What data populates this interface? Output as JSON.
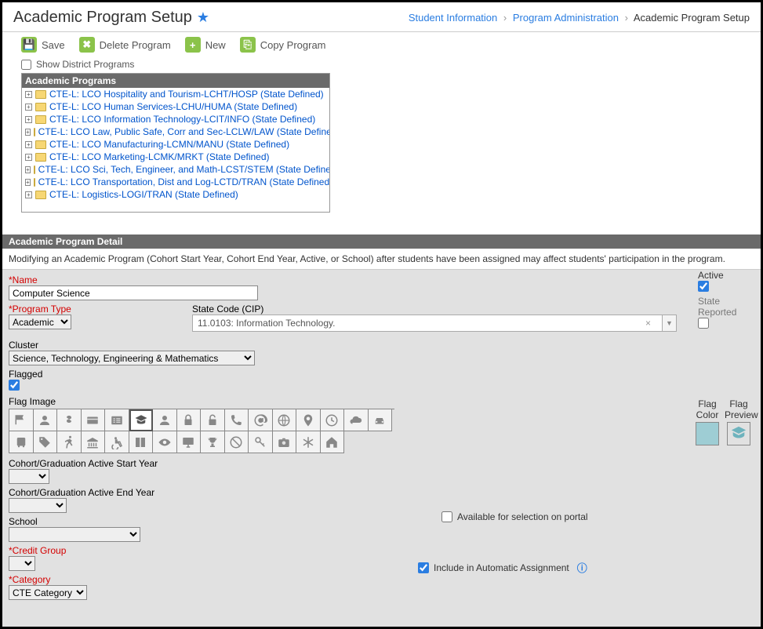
{
  "header": {
    "title": "Academic Program Setup",
    "breadcrumb": [
      "Student Information",
      "Program Administration",
      "Academic Program Setup"
    ]
  },
  "toolbar": {
    "save": "Save",
    "delete": "Delete Program",
    "new": "New",
    "copy": "Copy Program"
  },
  "district_checkbox": "Show District Programs",
  "tree": {
    "header": "Academic Programs",
    "items": [
      "CTE-L: LCO Hospitality and Tourism-LCHT/HOSP (State Defined)",
      "CTE-L: LCO Human Services-LCHU/HUMA (State Defined)",
      "CTE-L: LCO Information Technology-LCIT/INFO (State Defined)",
      "CTE-L: LCO Law, Public Safe, Corr and Sec-LCLW/LAW (State Defined)",
      "CTE-L: LCO Manufacturing-LCMN/MANU (State Defined)",
      "CTE-L: LCO Marketing-LCMK/MRKT (State Defined)",
      "CTE-L: LCO Sci, Tech, Engineer, and Math-LCST/STEM (State Defined)",
      "CTE-L: LCO Transportation, Dist and Log-LCTD/TRAN (State Defined)",
      "CTE-L: Logistics-LOGI/TRAN (State Defined)"
    ]
  },
  "detail": {
    "header": "Academic Program Detail",
    "warning": "Modifying an Academic Program (Cohort Start Year, Cohort End Year, Active, or School) after students have been assigned may affect students' participation in the program.",
    "labels": {
      "name": "*Name",
      "program_type": "*Program Type",
      "state_code": "State Code (CIP)",
      "active": "Active",
      "state_reported": "State Reported",
      "cluster": "Cluster",
      "flagged": "Flagged",
      "flag_image": "Flag Image",
      "flag_color": "Flag Color",
      "flag_preview": "Flag Preview",
      "cohort_start": "Cohort/Graduation Active Start Year",
      "cohort_end": "Cohort/Graduation Active End Year",
      "school": "School",
      "credit_group": "*Credit Group",
      "category": "*Category",
      "available_portal": "Available for selection on portal",
      "include_auto": "Include in Automatic Assignment"
    },
    "values": {
      "name": "Computer Science",
      "program_type": "Academic",
      "state_code": "11.0103: Information Technology.",
      "cluster": "Science, Technology, Engineering & Mathematics",
      "category": "CTE Category",
      "active": true,
      "state_reported": false,
      "flagged": true,
      "available_portal": false,
      "include_auto": true
    },
    "flag_icons": [
      "flag",
      "user",
      "dollar",
      "card",
      "list",
      "graduate",
      "user-fill",
      "lock",
      "unlock",
      "phone",
      "at",
      "globe",
      "pin",
      "clock",
      "cloud",
      "car",
      "bus",
      "tag",
      "run",
      "bank",
      "wheelchair",
      "book",
      "eye",
      "monitor",
      "trophy",
      "ban",
      "key",
      "camera",
      "asterisk",
      "home"
    ],
    "selected_flag_index": 5
  }
}
